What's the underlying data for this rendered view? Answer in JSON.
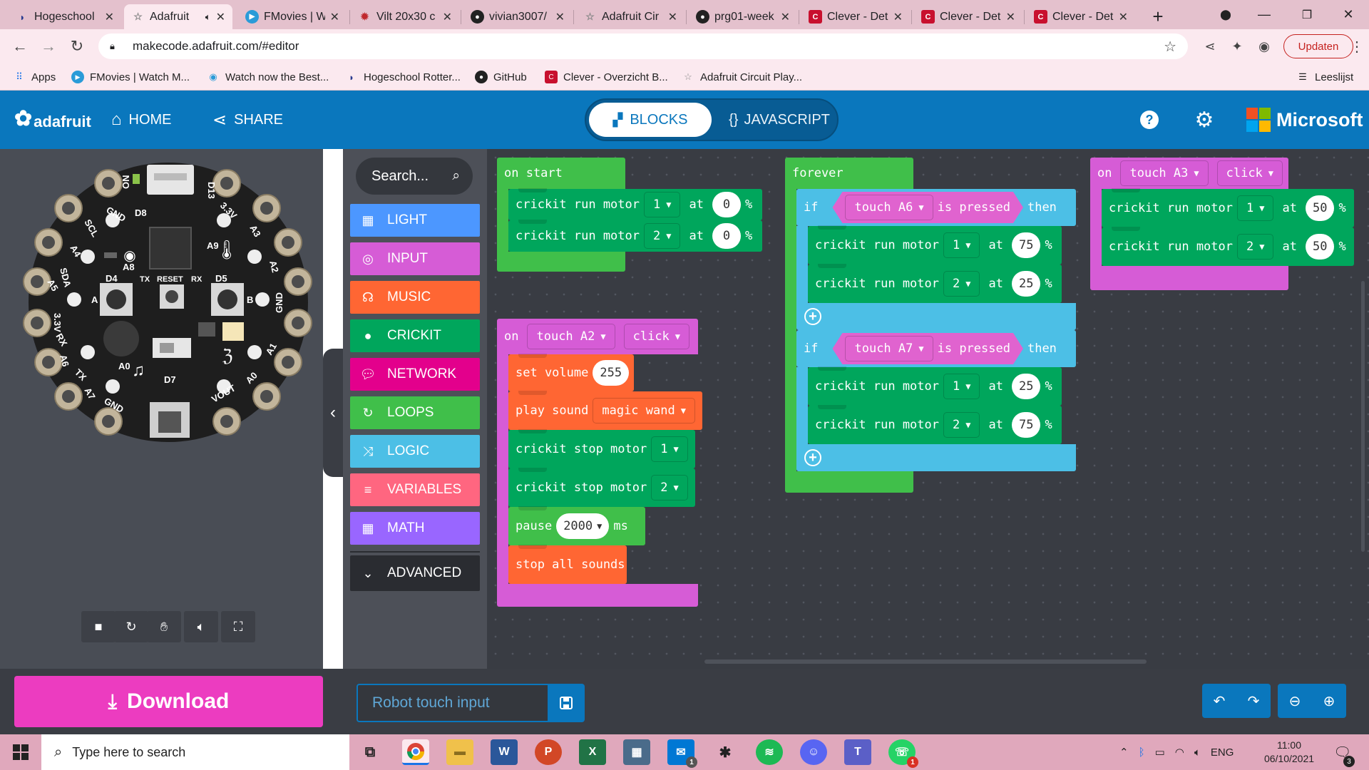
{
  "browser": {
    "tabs": [
      {
        "label": "Hogeschool",
        "active": false
      },
      {
        "label": "Adafruit",
        "active": true,
        "muted_icon": "speaker-icon"
      },
      {
        "label": "FMovies | W",
        "active": false
      },
      {
        "label": "Vilt 20x30 c",
        "active": false
      },
      {
        "label": "vivian3007/",
        "active": false
      },
      {
        "label": "Adafruit Cir",
        "active": false
      },
      {
        "label": "prg01-week",
        "active": false
      },
      {
        "label": "Clever - Det",
        "active": false
      },
      {
        "label": "Clever - Det",
        "active": false
      },
      {
        "label": "Clever - Det",
        "active": false
      }
    ],
    "new_tab": "+",
    "url": "makecode.adafruit.com/#editor",
    "update_label": "Updaten",
    "bookmarks": [
      {
        "label": "Apps",
        "icon": "apps-grid-icon"
      },
      {
        "label": "FMovies | Watch M...",
        "icon": "play-icon"
      },
      {
        "label": "Watch now the Best...",
        "icon": "play-circle-icon"
      },
      {
        "label": "Hogeschool Rotter...",
        "icon": "hr-logo-icon"
      },
      {
        "label": "GitHub",
        "icon": "github-icon"
      },
      {
        "label": "Clever - Overzicht B...",
        "icon": "clever-icon"
      },
      {
        "label": "Adafruit Circuit Play...",
        "icon": "star-icon"
      }
    ],
    "reading_list": "Leeslijst"
  },
  "header": {
    "brand": "adafruit",
    "home": "HOME",
    "share": "SHARE",
    "blocks": "BLOCKS",
    "javascript": "JAVASCRIPT",
    "microsoft": "Microsoft"
  },
  "board_labels": {
    "gnd": "GND",
    "d13": "D13",
    "d8": "D8",
    "scl": "SCL",
    "a4": "A4",
    "sda": "SDA",
    "a5": "A5",
    "v33_left": "3.3V",
    "rx": "RX",
    "a6": "A6",
    "tx": "TX",
    "a7": "A7",
    "gnd_bottom": "GND",
    "d4": "D4",
    "reset": "RESET",
    "d5": "D5",
    "a8": "A8",
    "a9": "A9",
    "a0": "A0",
    "d7": "D7",
    "vout": "VOUT",
    "v33_right": "3.3V",
    "a3": "A3",
    "a2": "A2",
    "gnd_right": "GND",
    "a1": "A1",
    "a0_right": "A0",
    "on": "ON",
    "btn_a": "A",
    "btn_b": "B"
  },
  "toolbox": {
    "search_placeholder": "Search...",
    "categories": [
      {
        "label": "LIGHT",
        "color": "#4c97ff",
        "icon": "grid-icon"
      },
      {
        "label": "INPUT",
        "color": "#d65cd6",
        "icon": "target-icon"
      },
      {
        "label": "MUSIC",
        "color": "#ff6633",
        "icon": "headphones-icon"
      },
      {
        "label": "CRICKIT",
        "color": "#00a65c",
        "icon": "circle-icon"
      },
      {
        "label": "NETWORK",
        "color": "#e3008c",
        "icon": "chat-icon"
      },
      {
        "label": "LOOPS",
        "color": "#40bf4a",
        "icon": "refresh-icon"
      },
      {
        "label": "LOGIC",
        "color": "#4cbfe6",
        "icon": "shuffle-icon"
      },
      {
        "label": "VARIABLES",
        "color": "#ff6680",
        "icon": "list-icon"
      },
      {
        "label": "MATH",
        "color": "#9966ff",
        "icon": "calculator-icon"
      }
    ],
    "advanced": "ADVANCED"
  },
  "blocks": {
    "on_start": {
      "label": "on start",
      "m1": {
        "text": "crickit run motor",
        "motor": "1",
        "at": "at",
        "value": "0",
        "pct": "%"
      },
      "m2": {
        "text": "crickit run motor",
        "motor": "2",
        "at": "at",
        "value": "0",
        "pct": "%"
      }
    },
    "on_touch_a2": {
      "on": "on",
      "pin": "touch A2",
      "event": "click",
      "set_volume": "set volume",
      "volume": "255",
      "play_sound": "play sound",
      "sound": "magic wand",
      "stop1": "crickit stop motor",
      "stop1_motor": "1",
      "stop2": "crickit stop motor",
      "stop2_motor": "2",
      "pause": "pause",
      "pause_value": "2000",
      "ms": "ms",
      "stop_all": "stop all sounds"
    },
    "forever": {
      "label": "forever",
      "if1": {
        "if": "if",
        "pin": "touch A6",
        "is_pressed": "is pressed",
        "then": "then",
        "m1": {
          "text": "crickit run motor",
          "motor": "1",
          "at": "at",
          "value": "75",
          "pct": "%"
        },
        "m2": {
          "text": "crickit run motor",
          "motor": "2",
          "at": "at",
          "value": "25",
          "pct": "%"
        }
      },
      "if2": {
        "if": "if",
        "pin": "touch A7",
        "is_pressed": "is pressed",
        "then": "then",
        "m1": {
          "text": "crickit run motor",
          "motor": "1",
          "at": "at",
          "value": "25",
          "pct": "%"
        },
        "m2": {
          "text": "crickit run motor",
          "motor": "2",
          "at": "at",
          "value": "75",
          "pct": "%"
        }
      }
    },
    "on_touch_a3": {
      "on": "on",
      "pin": "touch A3",
      "event": "click",
      "m1": {
        "text": "crickit run motor",
        "motor": "1",
        "at": "at",
        "value": "50",
        "pct": "%"
      },
      "m2": {
        "text": "crickit run motor",
        "motor": "2",
        "at": "at",
        "value": "50",
        "pct": "%"
      }
    }
  },
  "bottom": {
    "download": "Download",
    "project_name": "Robot touch input"
  },
  "taskbar": {
    "search_placeholder": "Type here to search",
    "lang": "ENG",
    "time": "11:00",
    "date": "06/10/2021",
    "mail_badge": "1",
    "whatsapp_badge": "1",
    "notif_badge": "3"
  },
  "colors": {
    "header_blue": "#0a77bd",
    "loops": "#40bf4a",
    "crickit": "#00a65c",
    "input": "#d65cd6",
    "music": "#ff6633",
    "logic": "#4cbfe6",
    "download_pink": "#ec3cc0"
  }
}
